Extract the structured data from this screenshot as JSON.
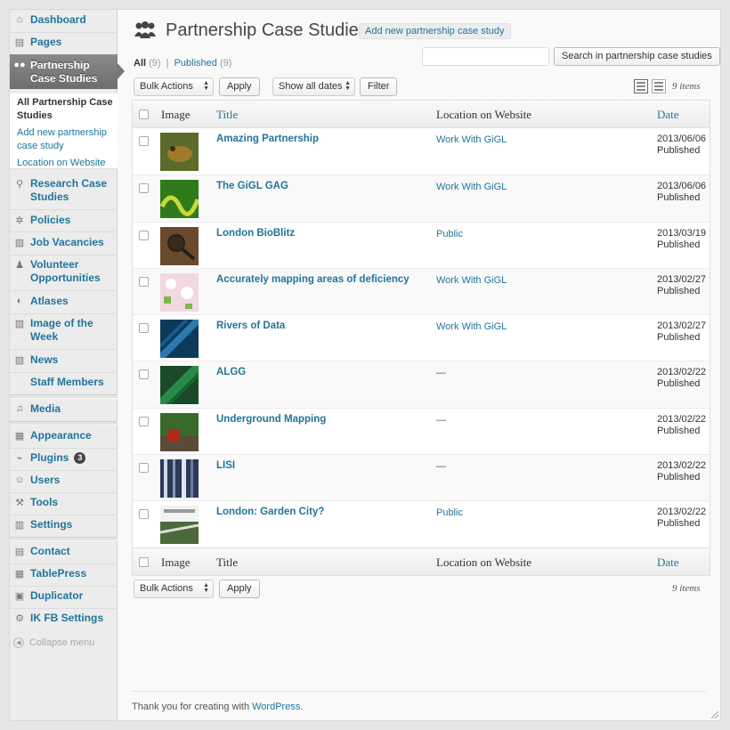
{
  "sidebar": {
    "items": [
      {
        "label": "Dashboard",
        "icon": "house-icon"
      },
      {
        "label": "Pages",
        "icon": "pages-icon"
      },
      {
        "label": "Partnership Case Studies",
        "icon": "people-icon"
      },
      {
        "label": "Research Case Studies",
        "icon": "magnifier-icon"
      },
      {
        "label": "Policies",
        "icon": "gear-icon"
      },
      {
        "label": "Job Vacancies",
        "icon": "image-icon"
      },
      {
        "label": "Volunteer Opportunities",
        "icon": "people-icon"
      },
      {
        "label": "Atlases",
        "icon": "globe-icon"
      },
      {
        "label": "Image of the Week",
        "icon": "image-icon"
      },
      {
        "label": "News",
        "icon": "image-icon"
      },
      {
        "label": "Staff Members",
        "icon": ""
      },
      {
        "label": "Media",
        "icon": "media-icon"
      },
      {
        "label": "Appearance",
        "icon": "appearance-icon"
      },
      {
        "label": "Plugins",
        "icon": "plug-icon",
        "badge": "3"
      },
      {
        "label": "Users",
        "icon": "users-icon"
      },
      {
        "label": "Tools",
        "icon": "tools-icon"
      },
      {
        "label": "Settings",
        "icon": "settings-icon"
      },
      {
        "label": "Contact",
        "icon": "contact-icon"
      },
      {
        "label": "TablePress",
        "icon": "table-icon"
      },
      {
        "label": "Duplicator",
        "icon": "duplicator-icon"
      },
      {
        "label": "IK FB Settings",
        "icon": "gear-icon"
      }
    ],
    "submenu": [
      "All Partnership Case Studies",
      "Add new partnership case study",
      "Location on Website"
    ],
    "collapse": "Collapse menu"
  },
  "page": {
    "title": "Partnership Case Studies",
    "add_new": "Add new partnership case study",
    "views_all": "All",
    "views_all_count": "(9)",
    "views_sep": "|",
    "views_published": "Published",
    "views_published_count": "(9)",
    "search_button": "Search in partnership case studies",
    "search_placeholder": "",
    "bulk_actions": "Bulk Actions",
    "apply": "Apply",
    "show_all_dates": "Show all dates",
    "filter": "Filter",
    "items_count": "9 items"
  },
  "table": {
    "columns": {
      "image": "Image",
      "title": "Title",
      "location": "Location on Website",
      "date": "Date"
    },
    "rows": [
      {
        "title": "Amazing Partnership",
        "location": "Work With GiGL",
        "date": "2013/06/06",
        "status": "Published",
        "thumb": "frog-thumbnail"
      },
      {
        "title": "The GiGL GAG",
        "location": "Work With GiGL",
        "date": "2013/06/06",
        "status": "Published",
        "thumb": "snake-thumbnail"
      },
      {
        "title": "London BioBlitz",
        "location": "Public",
        "date": "2013/03/19",
        "status": "Published",
        "thumb": "magnifying-glass-thumbnail"
      },
      {
        "title": "Accurately mapping areas of deficiency",
        "location": "Work With GiGL",
        "date": "2013/02/27",
        "status": "Published",
        "thumb": "map-thumbnail"
      },
      {
        "title": "Rivers of Data",
        "location": "Work With GiGL",
        "date": "2013/02/27",
        "status": "Published",
        "thumb": "blue-leaf-thumbnail"
      },
      {
        "title": "ALGG",
        "location": "—",
        "date": "2013/02/22",
        "status": "Published",
        "thumb": "green-leaf-thumbnail"
      },
      {
        "title": "Underground Mapping",
        "location": "—",
        "date": "2013/02/22",
        "status": "Published",
        "thumb": "garden-thumbnail"
      },
      {
        "title": "LISI",
        "location": "—",
        "date": "2013/02/22",
        "status": "Published",
        "thumb": "bars-thumbnail"
      },
      {
        "title": "London: Garden City?",
        "location": "Public",
        "date": "2013/02/22",
        "status": "Published",
        "thumb": "document-thumbnail"
      }
    ]
  },
  "footer": {
    "text": "Thank you for creating with ",
    "link": "WordPress",
    "end": "."
  },
  "colors": {
    "link": "#21759b",
    "active_menu": "#787878"
  }
}
